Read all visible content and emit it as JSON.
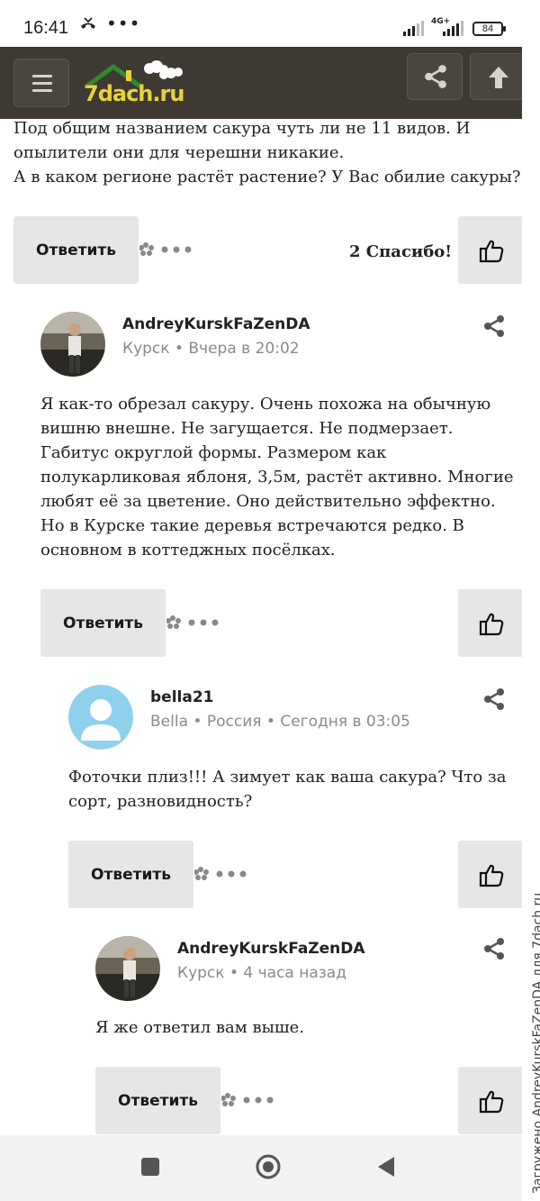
{
  "status_bar": {
    "time": "16:41",
    "dots": "•••",
    "network": "4G+",
    "battery": "84"
  },
  "header": {
    "logo_text": "7dach.ru"
  },
  "intro": {
    "text": "Под общим названием сакура чуть ли не 11 видов. И\nопылители они для черешни никакие.\nА в каком регионе растёт растение? У Вас обилие сакуры?",
    "reply_label": "Ответить",
    "thanks": "2 Спасибо!"
  },
  "comments": [
    {
      "author": "AndreyKurskFaZenDA",
      "location": "Курск",
      "time": "Вчера в 20:02",
      "text": "Я как-то обрезал сакуру. Очень похожа на обычную\nвишню внешне. Не загущается. Не подмерзает.\nГабитус округлой формы. Размером как\nполукарликовая яблоня, 3,5м, растёт активно. Многие\nлюбят её за цветение. Оно действительно эффектно.\nНо в Курске такие деревья встречаются редко. В\nосновном в коттеджных посёлках.",
      "reply_label": "Ответить"
    },
    {
      "author": "bella21",
      "name": "Bella",
      "location": "Россия",
      "time": "Сегодня в 03:05",
      "text": "Фоточки плиз!!! А зимует как ваша сакура? Что за\nсорт, разновидность?",
      "reply_label": "Ответить"
    },
    {
      "author": "AndreyKurskFaZenDA",
      "location": "Курск",
      "time": "4 часа назад",
      "text": "Я же ответил вам выше.",
      "reply_label": "Ответить"
    }
  ],
  "watermark": "Загружено AndreyKurskFaZenDA для 7dach.ru",
  "colors": {
    "header_bg": "#3e3a33",
    "button_bg": "#e6e6e6",
    "logo_green": "#2e8b2e",
    "logo_yellow": "#e8d23a"
  }
}
